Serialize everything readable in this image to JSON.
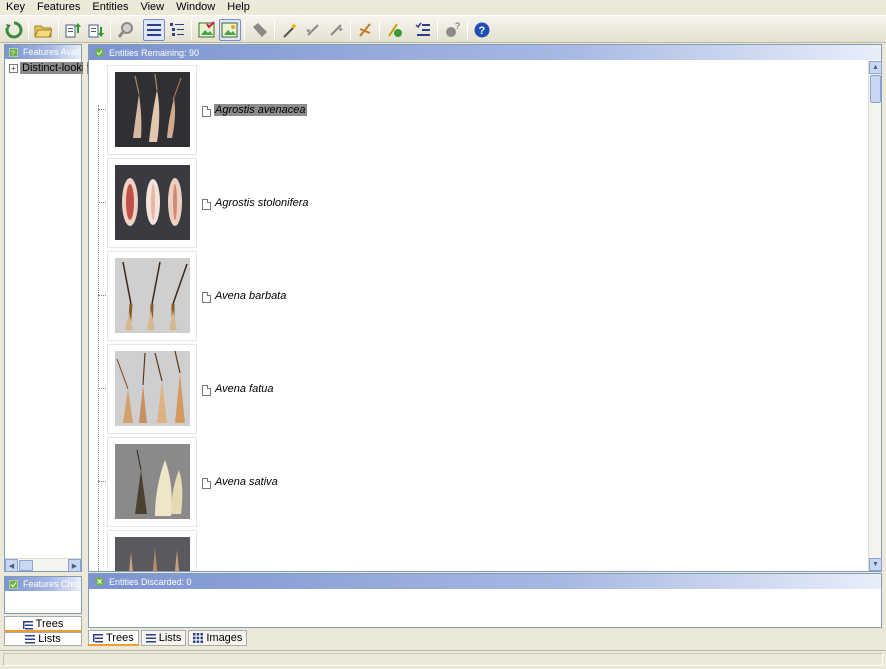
{
  "menu": [
    "Key",
    "Features",
    "Entities",
    "View",
    "Window",
    "Help"
  ],
  "toolbar": {
    "buttons": [
      {
        "icon": "restart-icon"
      },
      {
        "icon": "open-folder-icon"
      },
      {
        "icon": "export-up-icon"
      },
      {
        "icon": "export-down-icon"
      },
      {
        "icon": "search-icon"
      },
      {
        "icon": "list-view-icon",
        "pressed": true
      },
      {
        "icon": "tree-list-icon"
      },
      {
        "icon": "image-check-icon"
      },
      {
        "icon": "image-view-icon",
        "pressed": true
      },
      {
        "icon": "tag-icon"
      },
      {
        "icon": "magic-wand-icon"
      },
      {
        "icon": "back-arrow-icon"
      },
      {
        "icon": "forward-arrow-icon"
      },
      {
        "icon": "scissors-icon"
      },
      {
        "icon": "run-icon"
      },
      {
        "icon": "checklist-icon"
      },
      {
        "icon": "help-query-icon"
      },
      {
        "icon": "help-icon"
      }
    ]
  },
  "left_panel": {
    "features_available_title": "Features Available",
    "tree_item": "Distinct-looking",
    "features_chosen_title": "Features Chosen",
    "tab_trees": "Trees",
    "tab_lists": "Lists"
  },
  "main": {
    "remaining_title": "Entities Remaining: 90",
    "discarded_title": "Entities Discarded: 0",
    "entities": [
      {
        "name": "Agrostis avenacea",
        "selected": true,
        "image": "agrostis-avenacea"
      },
      {
        "name": "Agrostis stolonifera",
        "selected": false,
        "image": "agrostis-stolonifera"
      },
      {
        "name": "Avena barbata",
        "selected": false,
        "image": "avena-barbata"
      },
      {
        "name": "Avena fatua",
        "selected": false,
        "image": "avena-fatua"
      },
      {
        "name": "Avena sativa",
        "selected": false,
        "image": "avena-sativa"
      },
      {
        "name": "",
        "selected": false,
        "image": "partial"
      }
    ],
    "tabs": [
      "Trees",
      "Lists",
      "Images"
    ]
  },
  "colors": {
    "accent": "#f29c2f",
    "panel_border": "#7f9db9",
    "header_gradient_start": "#7b93cf"
  }
}
